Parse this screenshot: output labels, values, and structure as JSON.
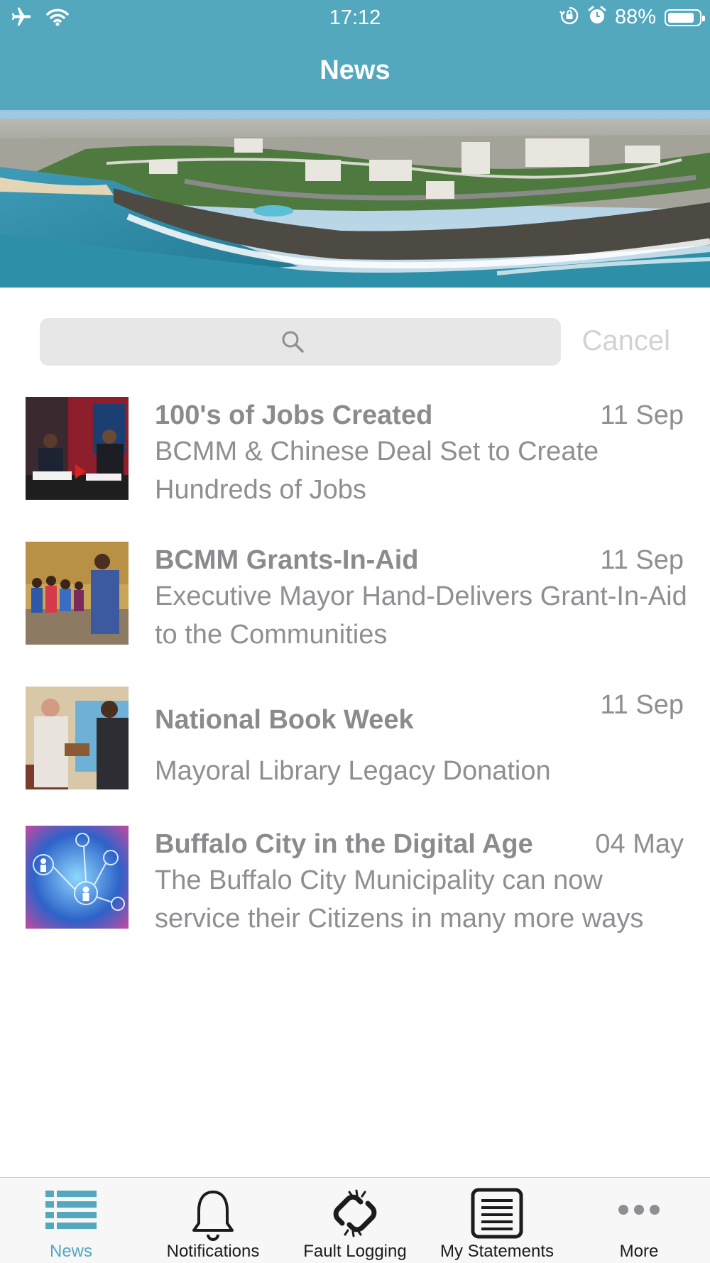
{
  "status_bar": {
    "time": "17:12",
    "battery_percent": "88%",
    "battery_level": 0.88,
    "icons": [
      "airplane-icon",
      "wifi-icon",
      "rotation-lock-icon",
      "alarm-icon",
      "battery-icon"
    ]
  },
  "header": {
    "title": "News"
  },
  "search": {
    "placeholder": "",
    "cancel_label": "Cancel"
  },
  "news": [
    {
      "title": "100's of Jobs Created",
      "date": "11 Sep",
      "subtitle": "BCMM & Chinese Deal Set to Create Hundreds of Jobs"
    },
    {
      "title": "BCMM Grants-In-Aid",
      "date": "11 Sep",
      "subtitle": "Executive Mayor Hand-Delivers Grant-In-Aid to the Communities"
    },
    {
      "title": "National Book Week",
      "date": "11 Sep",
      "subtitle": "Mayoral Library Legacy Donation"
    },
    {
      "title": "Buffalo City in the Digital Age",
      "date": "04 May",
      "subtitle": "The Buffalo City Municipality can now service their Citizens in many more ways"
    }
  ],
  "tab_bar": {
    "active": "News",
    "tabs": [
      {
        "label": "News",
        "icon": "list-icon"
      },
      {
        "label": "Notifications",
        "icon": "bell-icon"
      },
      {
        "label": "Fault Logging",
        "icon": "broken-link-icon"
      },
      {
        "label": "My Statements",
        "icon": "document-icon"
      },
      {
        "label": "More",
        "icon": "more-dots-icon"
      }
    ]
  },
  "colors": {
    "accent": "#53a8be",
    "text_gray": "#8e8e93",
    "tab_text": "#1c1c1e"
  }
}
